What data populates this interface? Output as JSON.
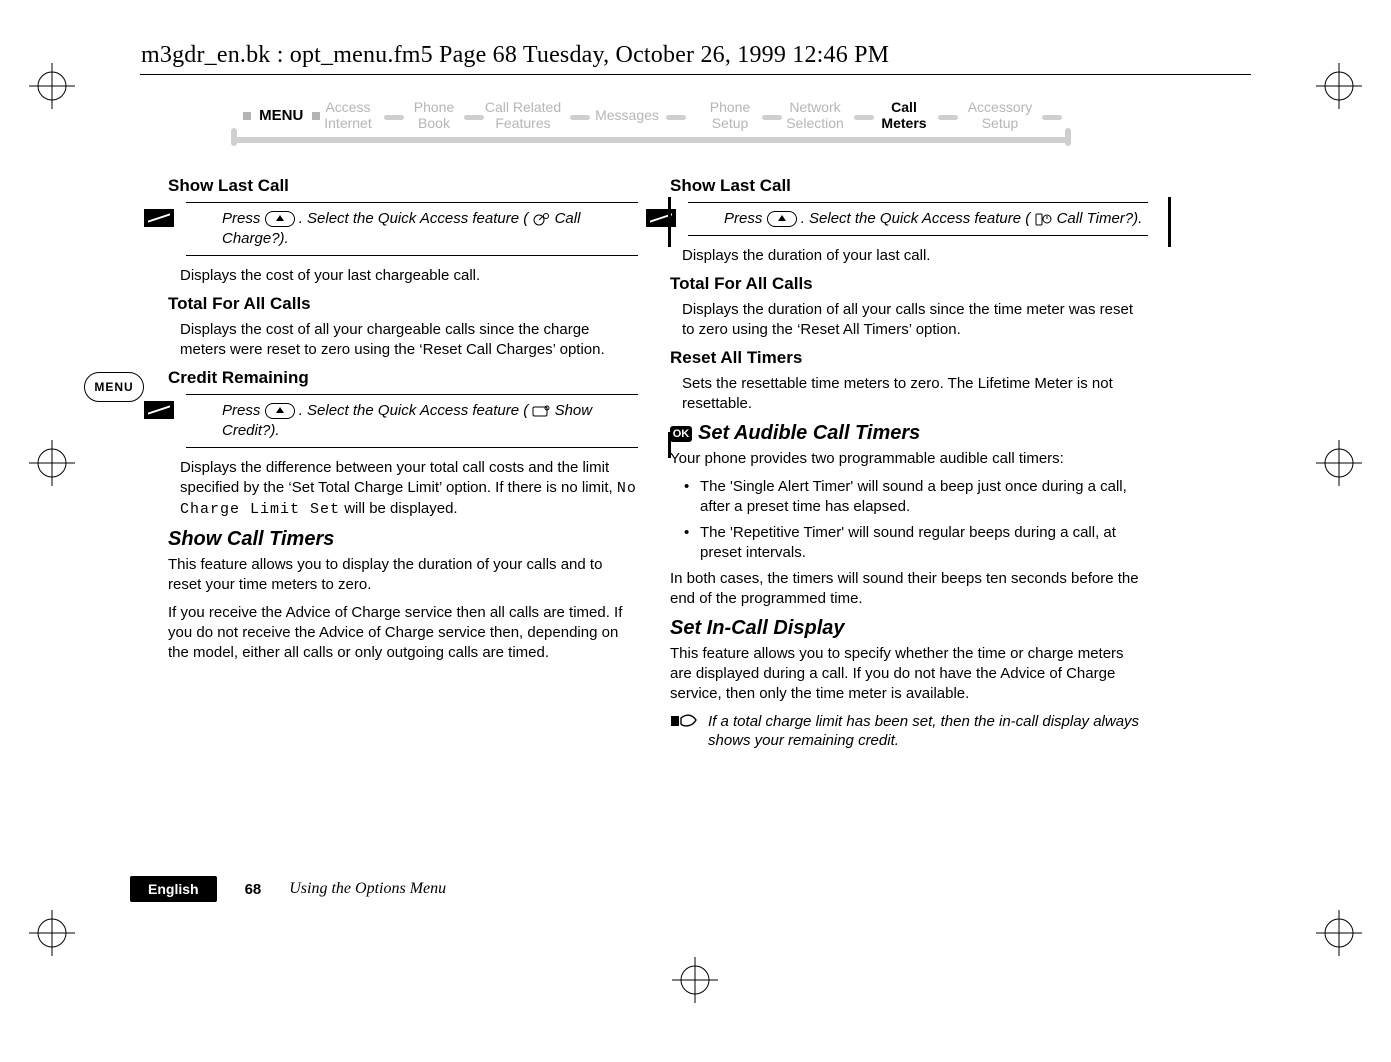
{
  "header": {
    "running_head": "m3gdr_en.bk : opt_menu.fm5  Page 68  Tuesday, October 26, 1999  12:46 PM"
  },
  "nav": {
    "menu_label": "MENU",
    "items": [
      {
        "l1": "Access",
        "l2": "Internet",
        "active": false
      },
      {
        "l1": "Phone",
        "l2": "Book",
        "active": false
      },
      {
        "l1": "Call Related",
        "l2": "Features",
        "active": false
      },
      {
        "l1": "Messages",
        "l2": "",
        "active": false
      },
      {
        "l1": "Phone",
        "l2": "Setup",
        "active": false
      },
      {
        "l1": "Network",
        "l2": "Selection",
        "active": false
      },
      {
        "l1": "Call",
        "l2": "Meters",
        "active": true
      },
      {
        "l1": "Accessory",
        "l2": "Setup",
        "active": false
      }
    ]
  },
  "side": {
    "menu_label": "MENU"
  },
  "left": {
    "show_last_call_h": "Show Last Call",
    "qa1_a": "Press ",
    "qa1_b": ". Select the Quick Access feature (",
    "qa1_c": " Call Charge?).",
    "show_last_call_body": "Displays the cost of your last chargeable call.",
    "total_h": "Total For All Calls",
    "total_body": "Displays the cost of all your chargeable calls since the charge meters were reset to zero using the ‘Reset Call Charges’ option.",
    "credit_h": "Credit Remaining",
    "qa2_a": "Press ",
    "qa2_b": ". Select the Quick Access feature (",
    "qa2_c": " Show Credit?).",
    "credit_body_a": "Displays the difference between your total call costs and the limit specified by the ‘Set Total Charge Limit’ option. If there is no limit, ",
    "credit_body_lcd": "No Charge Limit Set",
    "credit_body_b": " will be displayed.",
    "sct_h": "Show Call Timers",
    "sct_p1": "This feature allows you to display the duration of your calls and to reset your time meters to zero.",
    "sct_p2": "If you receive the Advice of Charge service then all calls are timed. If you do not receive the Advice of Charge service then, depending on the model, either all calls or only outgoing calls are timed."
  },
  "right": {
    "show_last_call_h": "Show Last Call",
    "qa3_a": "Press ",
    "qa3_b": ". Select the Quick Access feature (",
    "qa3_c": " Call Timer?).",
    "show_last_call_body": "Displays the duration of your last call.",
    "total_h": "Total For All Calls",
    "total_body": "Displays the duration of all your calls since the time meter was reset to zero using the ‘Reset All Timers’ option.",
    "reset_h": "Reset All Timers",
    "reset_body": "Sets the resettable time meters to zero. The Lifetime Meter is not resettable.",
    "ok_label": "OK",
    "sact_h": "Set Audible Call Timers",
    "sact_p1": "Your phone provides two programmable audible call timers:",
    "sact_li1": "The 'Single Alert Timer' will sound a beep just once during a call, after a preset time has elapsed.",
    "sact_li2": "The 'Repetitive Timer' will sound regular beeps during a call, at preset intervals.",
    "sact_p2": "In both cases, the timers will sound their beeps ten seconds before the end of the programmed time.",
    "sicd_h": "Set In-Call Display",
    "sicd_p1": "This feature allows you to specify whether the time or charge meters are displayed during a call. If you do not have the Advice of Charge service, then only the time meter is available.",
    "note": "If a total charge limit has been set, then the in-call display always shows your remaining credit."
  },
  "footer": {
    "language": "English",
    "page": "68",
    "chapter": "Using the Options Menu"
  }
}
